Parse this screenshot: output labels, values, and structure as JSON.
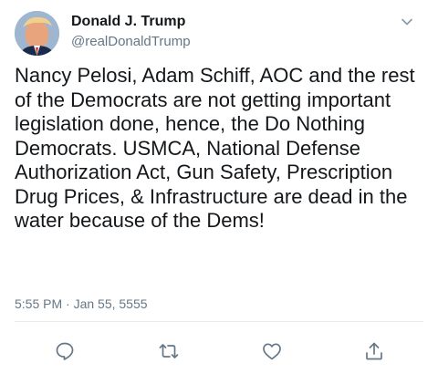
{
  "tweet": {
    "author_name": "Donald J. Trump",
    "author_handle": "@realDonaldTrump",
    "text": "Nancy Pelosi, Adam Schiff, AOC and the rest of the Democrats are not getting important legislation done, hence, the Do Nothing Democrats. USMCA, National Defense Authorization Act, Gun Safety, Prescription Drug Prices, & Infrastructure are dead in the water because of the Dems!",
    "timestamp": "5:55 PM · Jan 55, 5555"
  },
  "icons": {
    "menu": "chevron-down-icon",
    "reply": "reply-icon",
    "retweet": "retweet-icon",
    "like": "heart-icon",
    "share": "share-icon"
  },
  "colors": {
    "text": "#14171a",
    "secondary": "#657786",
    "icon": "#657786",
    "divider": "#e6ecf0"
  }
}
